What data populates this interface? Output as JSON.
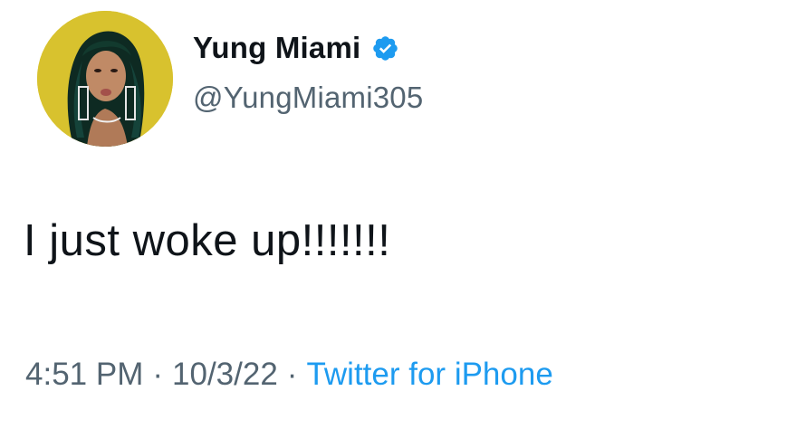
{
  "tweet": {
    "author": {
      "display_name": "Yung Miami",
      "handle": "@YungMiami305",
      "verified_icon": "verified-badge-icon",
      "avatar_icon": "profile-photo"
    },
    "text": "I just woke up!!!!!!!",
    "meta": {
      "time": "4:51 PM",
      "separator": "·",
      "date": "10/3/22",
      "source": "Twitter for iPhone"
    }
  },
  "colors": {
    "primary_text": "#0f1419",
    "secondary_text": "#536471",
    "link": "#1d9bf0",
    "verified_badge": "#1d9bf0",
    "avatar_background": "#d9c12a"
  }
}
